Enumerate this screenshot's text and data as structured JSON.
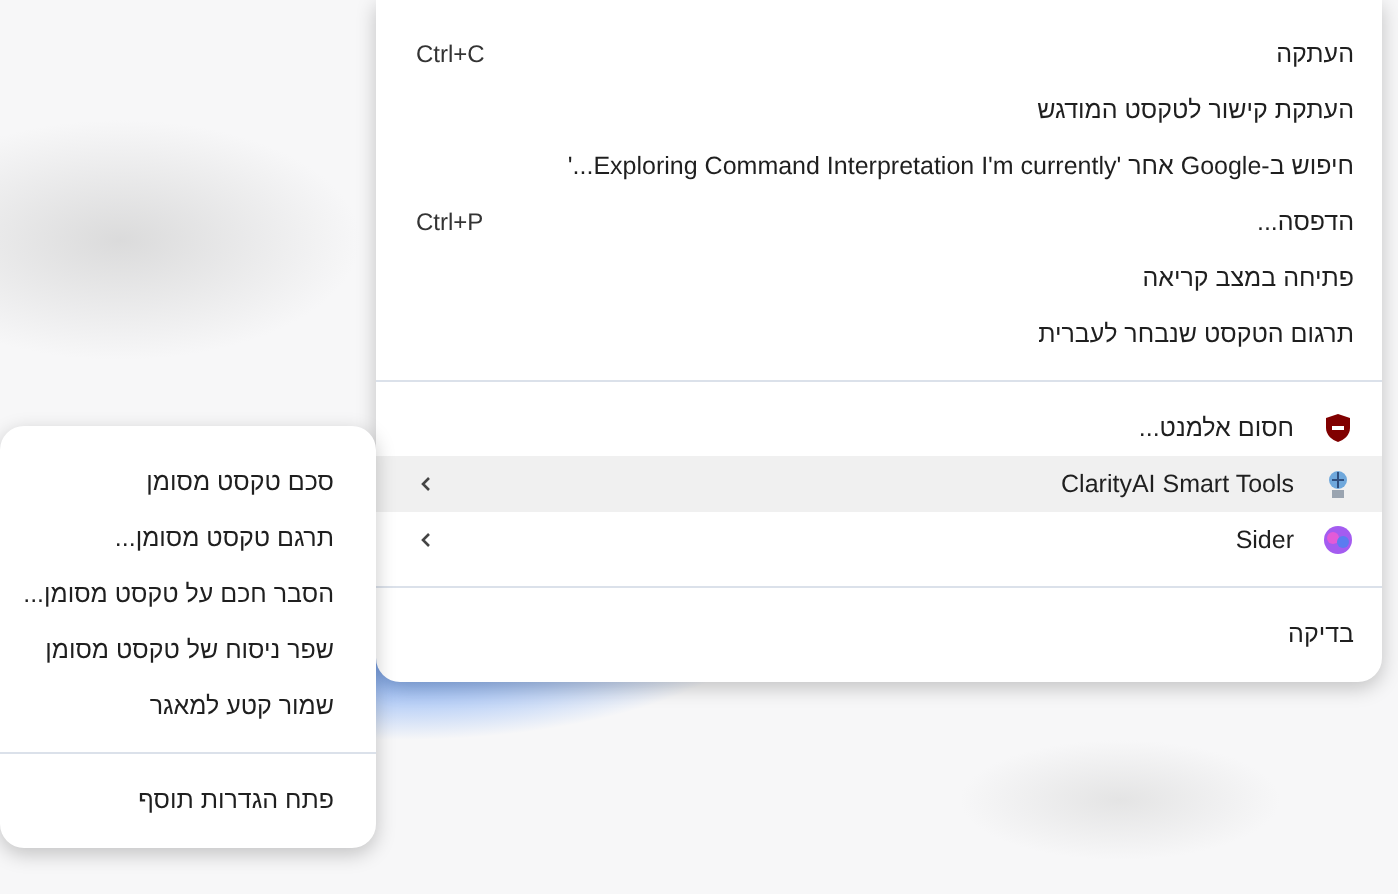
{
  "context_menu": {
    "groups": [
      [
        {
          "label": "העתקה",
          "shortcut": "Ctrl+C",
          "selected": false
        },
        {
          "label": "העתקת קישור לטקסט המודגש",
          "selected": false
        },
        {
          "label": "חיפוש ב-Google אחר 'Exploring Command Interpretation I'm currently...'",
          "selected": false
        },
        {
          "label": "הדפסה...",
          "shortcut": "Ctrl+P",
          "selected": false
        },
        {
          "label": "פתיחה במצב קריאה",
          "selected": false
        },
        {
          "label": "תרגום הטקסט שנבחר לעברית",
          "selected": false
        }
      ],
      [
        {
          "label": "חסום אלמנט...",
          "kind": "extension",
          "submenu": false,
          "selected": false
        },
        {
          "label": "ClarityAI Smart Tools",
          "kind": "extension",
          "submenu": true,
          "selected": true
        },
        {
          "label": "Sider",
          "kind": "extension",
          "submenu": true,
          "selected": false
        }
      ],
      [
        {
          "label": "בדיקה",
          "selected": false
        }
      ]
    ]
  },
  "submenu": {
    "groups": [
      [
        {
          "label": "סכם טקסט מסומן",
          "selected": false
        },
        {
          "label": "תרגם טקסט מסומן...",
          "selected": false
        },
        {
          "label": "הסבר חכם על טקסט מסומן...",
          "selected": false
        },
        {
          "label": "שפר ניסוח של טקסט מסומן",
          "selected": false
        },
        {
          "label": "שמור קטע למאגר",
          "selected": false
        }
      ],
      [
        {
          "label": "פתח הגדרות תוסף",
          "selected": false
        }
      ]
    ]
  }
}
